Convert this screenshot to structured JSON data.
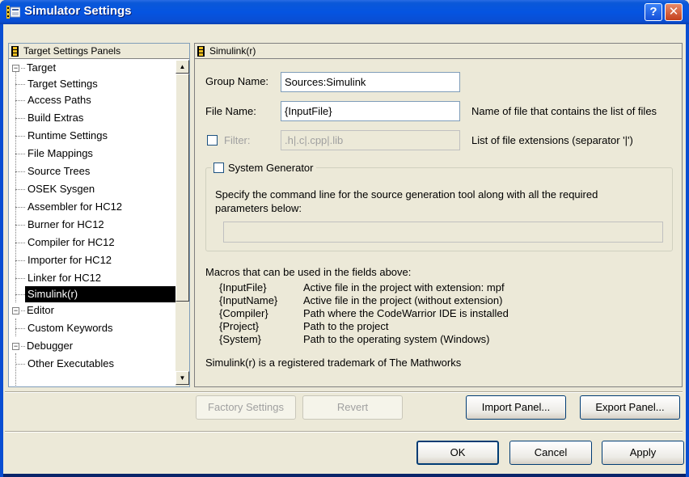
{
  "window": {
    "title": "Simulator Settings",
    "help_glyph": "?",
    "close_glyph": "✕"
  },
  "tree": {
    "header": "Target Settings Panels",
    "items": [
      {
        "label": "Target",
        "level": 0,
        "expander": "−"
      },
      {
        "label": "Target Settings",
        "level": 1
      },
      {
        "label": "Access Paths",
        "level": 1
      },
      {
        "label": "Build Extras",
        "level": 1
      },
      {
        "label": "Runtime Settings",
        "level": 1
      },
      {
        "label": "File Mappings",
        "level": 1
      },
      {
        "label": "Source Trees",
        "level": 1
      },
      {
        "label": "OSEK Sysgen",
        "level": 1
      },
      {
        "label": "Assembler for HC12",
        "level": 1
      },
      {
        "label": "Burner for HC12",
        "level": 1
      },
      {
        "label": "Compiler for HC12",
        "level": 1
      },
      {
        "label": "Importer for HC12",
        "level": 1
      },
      {
        "label": "Linker for HC12",
        "level": 1
      },
      {
        "label": "Simulink(r)",
        "level": 1,
        "selected": true
      },
      {
        "label": "Editor",
        "level": 0,
        "expander": "−"
      },
      {
        "label": "Custom Keywords",
        "level": 1
      },
      {
        "label": "Debugger",
        "level": 0,
        "expander": "−"
      },
      {
        "label": "Other Executables",
        "level": 1
      }
    ]
  },
  "panel": {
    "header": "Simulink(r)",
    "group_name_label": "Group Name:",
    "group_name_value": "Sources:Simulink",
    "file_name_label": "File Name:",
    "file_name_value": "{InputFile}",
    "file_name_hint": "Name of file that contains the list of files",
    "filter_label": "Filter:",
    "filter_value": ".h|.c|.cpp|.lib",
    "filter_hint": "List of file extensions (separator '|')",
    "system_generator": {
      "title": "System Generator",
      "description_line1": "Specify the command line for the source generation tool along with all the required",
      "description_line2": "parameters below:",
      "command_value": ""
    },
    "macros_title": "Macros that can be used in the fields above:",
    "macros": [
      {
        "name": "{InputFile}",
        "desc": "Active file in the project with extension: mpf"
      },
      {
        "name": "{InputName}",
        "desc": "Active file in the project (without extension)"
      },
      {
        "name": "{Compiler}",
        "desc": "Path where the CodeWarrior IDE is installed"
      },
      {
        "name": "{Project}",
        "desc": "Path to the project"
      },
      {
        "name": "{System}",
        "desc": "Path to the operating system (Windows)"
      }
    ],
    "trademark": "Simulink(r) is a registered trademark of The Mathworks"
  },
  "buttons": {
    "factory_settings": "Factory Settings",
    "revert": "Revert",
    "import_panel": "Import Panel...",
    "export_panel": "Export Panel...",
    "ok": "OK",
    "cancel": "Cancel",
    "apply": "Apply"
  },
  "colors": {
    "titlebar": "#0554e1",
    "selection": "#000000",
    "disabled_text": "#a0a0a0"
  }
}
